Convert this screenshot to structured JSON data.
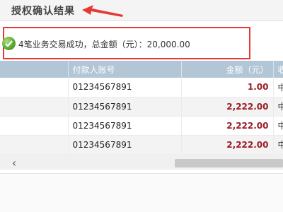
{
  "header": {
    "title": "授权确认结果"
  },
  "status": {
    "message": "4笔业务交易成功，总金额（元）：20,000.00",
    "icon": "success-check-icon"
  },
  "table": {
    "columns": [
      "",
      "付款人账号",
      "金额（元）",
      "收"
    ],
    "rows": [
      {
        "account": "01234567891",
        "amount": "1.00",
        "extra": "中"
      },
      {
        "account": "01234567891",
        "amount": "2,222.00",
        "extra": "中"
      },
      {
        "account": "01234567891",
        "amount": "2,222.00",
        "extra": "中"
      },
      {
        "account": "01234567891",
        "amount": "2,222.00",
        "extra": "中"
      }
    ]
  },
  "scrollbar": {
    "left_arrow": "‹"
  },
  "colors": {
    "highlight_border": "#e53935",
    "header_bg": "#b2c6d6",
    "amount": "#9b1b25",
    "success": "#5aa532"
  }
}
